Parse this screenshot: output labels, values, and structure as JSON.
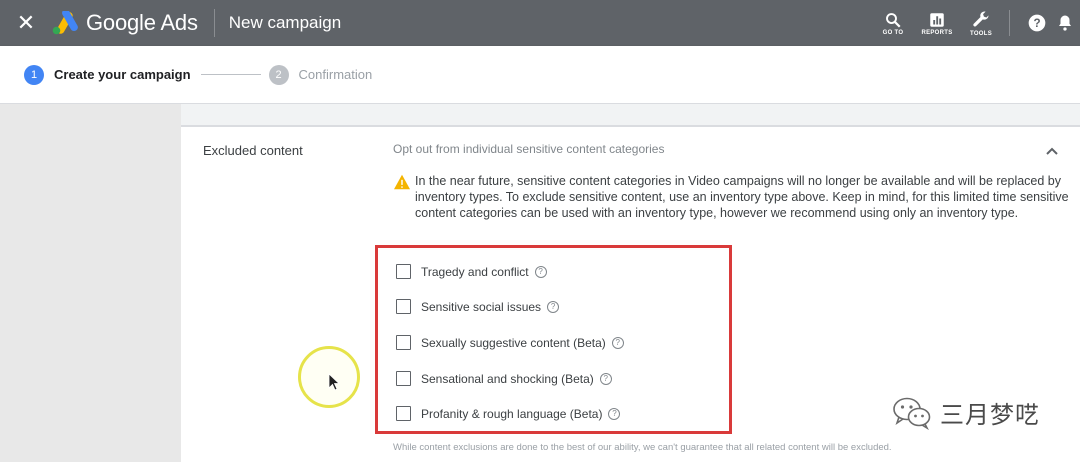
{
  "appbar": {
    "close_icon": "close-icon",
    "logo_text": "Google Ads",
    "title": "New campaign",
    "tools": [
      {
        "label": "GO TO",
        "icon": "search-icon"
      },
      {
        "label": "REPORTS",
        "icon": "reports-icon"
      },
      {
        "label": "TOOLS",
        "icon": "wrench-icon"
      }
    ],
    "help_icon": "help-icon",
    "notifications_icon": "bell-icon"
  },
  "stepper": {
    "steps": [
      {
        "num": "1",
        "label": "Create your campaign"
      },
      {
        "num": "2",
        "label": "Confirmation"
      }
    ]
  },
  "section": {
    "label": "Excluded content",
    "subtitle": "Opt out from individual sensitive content categories",
    "warning": "In the near future, sensitive content categories in Video campaigns will no longer be available and will be replaced by inventory types. To exclude sensitive content, use an inventory type above. Keep in mind, for this limited time sensitive content categories can be used with an inventory type, however we recommend using only an inventory type.",
    "categories": [
      {
        "label": "Tragedy and conflict",
        "checked": false
      },
      {
        "label": "Sensitive social issues",
        "checked": false
      },
      {
        "label": "Sexually suggestive content (Beta)",
        "checked": false
      },
      {
        "label": "Sensational and shocking (Beta)",
        "checked": false
      },
      {
        "label": "Profanity & rough language (Beta)",
        "checked": false
      }
    ],
    "disclaimer": "While content exclusions are done to the best of our ability, we can't guarantee that all related content will be excluded."
  },
  "watermark": {
    "text": "三月梦呓"
  },
  "colors": {
    "appbar": "#5f6368",
    "step_active": "#4285f4",
    "highlight_box": "#d93a3a",
    "warning": "#f4b400"
  }
}
